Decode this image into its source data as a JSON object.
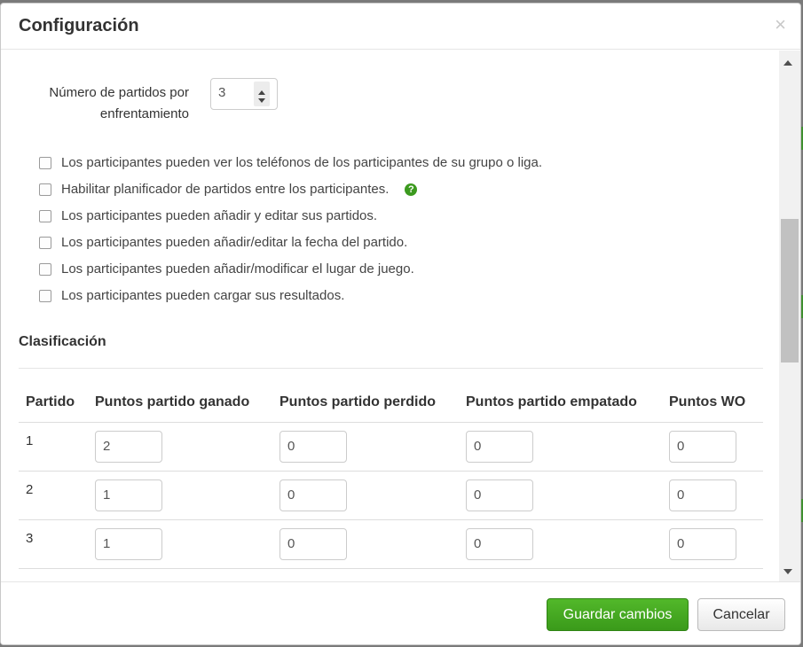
{
  "dialog": {
    "title": "Configuración",
    "close_label": "×"
  },
  "matches": {
    "label": "Número de partidos por enfrentamiento",
    "value": "3"
  },
  "options": [
    {
      "label": "Los participantes pueden ver los teléfonos de los participantes de su grupo o liga.",
      "checked": false,
      "help": false
    },
    {
      "label": "Habilitar planificador de partidos entre los participantes.",
      "checked": false,
      "help": true
    },
    {
      "label": "Los participantes pueden añadir y editar sus partidos.",
      "checked": false,
      "help": false
    },
    {
      "label": "Los participantes pueden añadir/editar la fecha del partido.",
      "checked": false,
      "help": false
    },
    {
      "label": "Los participantes pueden añadir/modificar el lugar de juego.",
      "checked": false,
      "help": false
    },
    {
      "label": "Los participantes pueden cargar sus resultados.",
      "checked": false,
      "help": false
    }
  ],
  "help_icon_glyph": "?",
  "classification": {
    "title": "Clasificación",
    "columns": [
      "Partido",
      "Puntos partido ganado",
      "Puntos partido perdido",
      "Puntos partido empatado",
      "Puntos WO"
    ],
    "rows": [
      {
        "match": "1",
        "won": "2",
        "lost": "0",
        "draw": "0",
        "wo": "0"
      },
      {
        "match": "2",
        "won": "1",
        "lost": "0",
        "draw": "0",
        "wo": "0"
      },
      {
        "match": "3",
        "won": "1",
        "lost": "0",
        "draw": "0",
        "wo": "0"
      }
    ]
  },
  "footer": {
    "save_label": "Guardar cambios",
    "cancel_label": "Cancelar"
  },
  "colors": {
    "accent_green": "#3a9a1a",
    "help_green": "#3c9a1f"
  }
}
